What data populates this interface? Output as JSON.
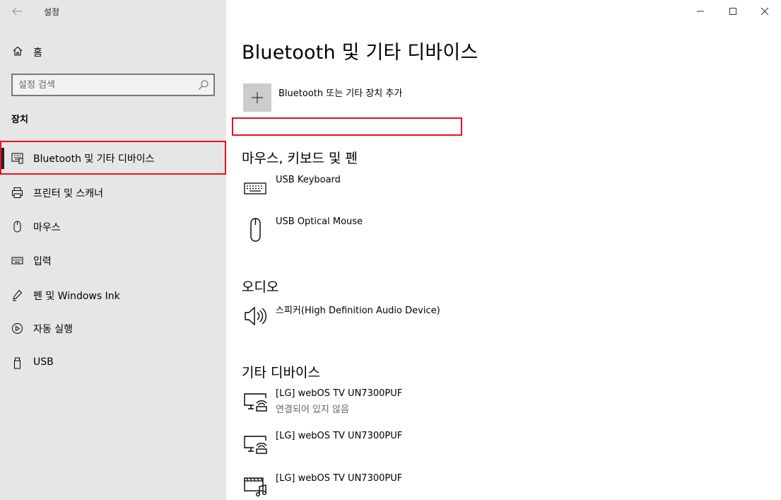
{
  "window": {
    "title": "설정",
    "back_icon": "back-arrow-icon",
    "controls": [
      "minimize",
      "maximize",
      "close"
    ]
  },
  "sidebar": {
    "home_label": "홈",
    "search_placeholder": "설정 검색",
    "section_title": "장치",
    "items": [
      {
        "label": "Bluetooth 및 기타 디바이스",
        "icon": "bluetooth-devices-icon",
        "selected": true
      },
      {
        "label": "프린터 및 스캐너",
        "icon": "printer-icon",
        "selected": false
      },
      {
        "label": "마우스",
        "icon": "mouse-icon",
        "selected": false
      },
      {
        "label": "입력",
        "icon": "keyboard-icon",
        "selected": false
      },
      {
        "label": "펜 및 Windows Ink",
        "icon": "pen-icon",
        "selected": false
      },
      {
        "label": "자동 실행",
        "icon": "autoplay-icon",
        "selected": false
      },
      {
        "label": "USB",
        "icon": "usb-icon",
        "selected": false
      }
    ]
  },
  "main": {
    "title": "Bluetooth 및 기타 디바이스",
    "add_device_label": "Bluetooth 또는 기타 장치 추가",
    "groups": [
      {
        "title": "마우스, 키보드 및 펜",
        "devices": [
          {
            "name": "USB Keyboard",
            "icon": "keyboard-icon"
          },
          {
            "name": "USB Optical Mouse",
            "icon": "mouse-icon"
          }
        ]
      },
      {
        "title": "오디오",
        "devices": [
          {
            "name": "스피커(High Definition Audio Device)",
            "icon": "speaker-icon"
          }
        ]
      },
      {
        "title": "기타 디바이스",
        "devices": [
          {
            "name": "[LG] webOS TV UN7300PUF",
            "status": "연결되어 있지 않음",
            "icon": "wireless-display-icon"
          },
          {
            "name": "[LG] webOS TV UN7300PUF",
            "icon": "wireless-display-icon"
          },
          {
            "name": "[LG] webOS TV UN7300PUF",
            "icon": "media-display-icon"
          }
        ]
      }
    ]
  },
  "colors": {
    "sidebar_bg": "#e6e6e6",
    "highlight_red": "#e81123",
    "add_tile_bg": "#cccccc",
    "secondary_text": "#666666"
  }
}
